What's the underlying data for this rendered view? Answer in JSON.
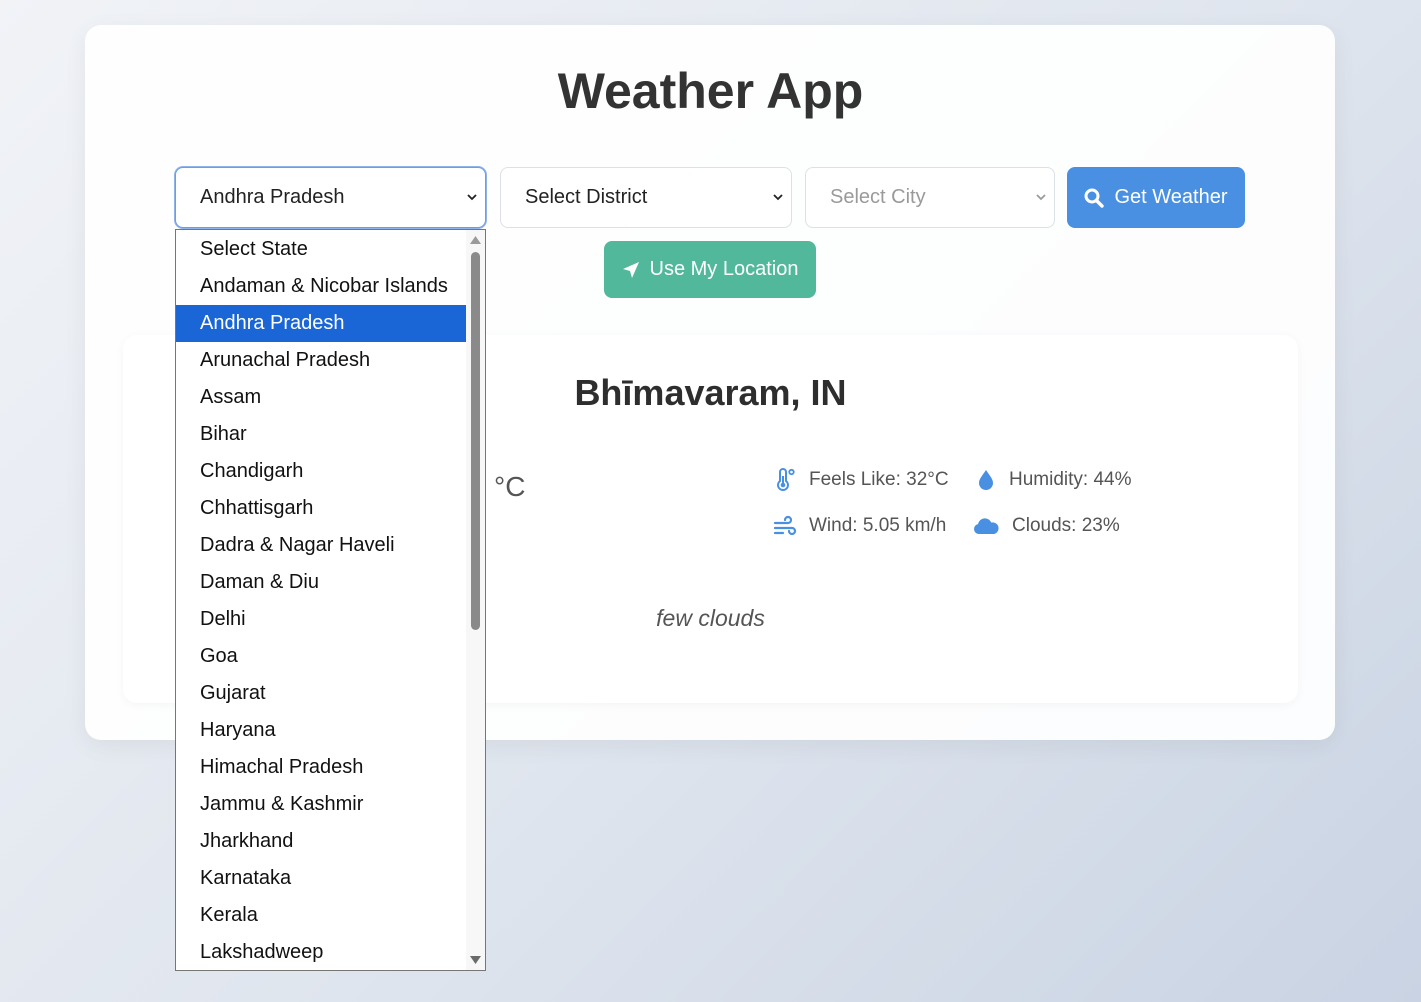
{
  "app": {
    "title": "Weather App"
  },
  "controls": {
    "state_value": "Andhra Pradesh",
    "district_value": "Select District",
    "city_value": "Select City",
    "get_weather_label": "Get Weather",
    "use_location_label": "Use My Location"
  },
  "state_options": [
    "Select State",
    "Andaman & Nicobar Islands",
    "Andhra Pradesh",
    "Arunachal Pradesh",
    "Assam",
    "Bihar",
    "Chandigarh",
    "Chhattisgarh",
    "Dadra & Nagar Haveli",
    "Daman & Diu",
    "Delhi",
    "Goa",
    "Gujarat",
    "Haryana",
    "Himachal Pradesh",
    "Jammu & Kashmir",
    "Jharkhand",
    "Karnataka",
    "Kerala",
    "Lakshadweep"
  ],
  "selected_state_index": 2,
  "weather": {
    "location": "Bhīmavaram, IN",
    "temp_unit": "°C",
    "feels_like": "Feels Like: 32°C",
    "humidity": "Humidity: 44%",
    "wind": "Wind: 5.05 km/h",
    "clouds": "Clouds: 23%",
    "description": "few clouds"
  },
  "colors": {
    "primary_blue": "#4a90e2",
    "teal": "#52b89c",
    "selected_option": "#1a66d6",
    "icon_blue": "#4a90e2"
  },
  "icons": {
    "search": "search-icon",
    "location": "location-arrow-icon",
    "thermometer": "thermometer-icon",
    "humidity": "droplet-icon",
    "wind": "wind-icon",
    "clouds": "cloud-icon"
  }
}
